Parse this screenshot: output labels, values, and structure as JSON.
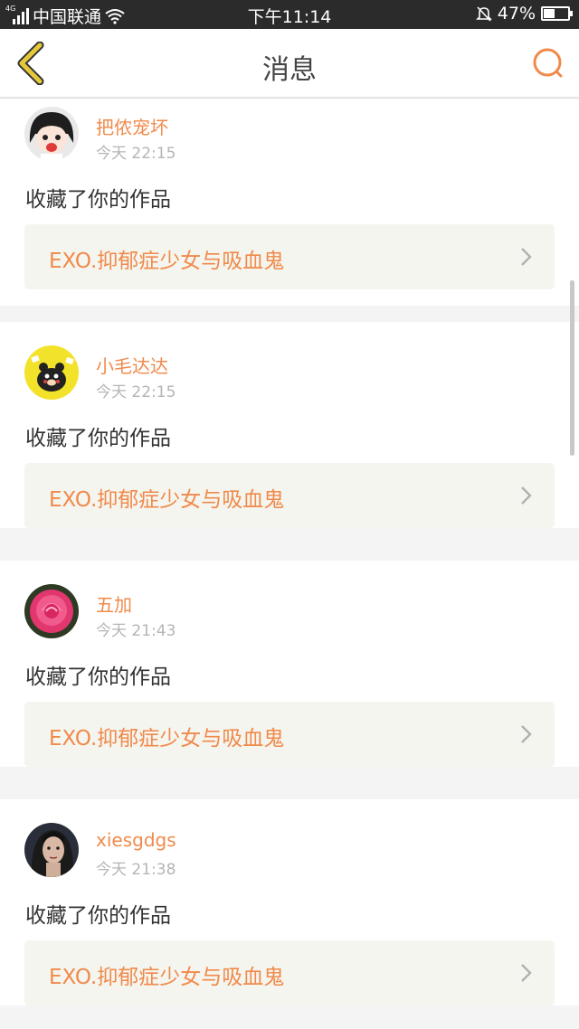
{
  "status_bar": {
    "network_label": "4G",
    "carrier": "中国联通",
    "time": "下午11:14",
    "battery_percent": "47%",
    "battery_level": 0.47,
    "icons": [
      "signal-icon",
      "wifi-icon",
      "mute-icon",
      "battery-icon"
    ]
  },
  "header": {
    "title": "消息",
    "back_icon": "chevron-left-icon",
    "search_icon": "search-icon"
  },
  "colors": {
    "accent": "#f08a4b",
    "back_icon": "#e6c93a",
    "link_bg": "#f5f5ef",
    "page_bg": "#f4f4f4",
    "status_bar_bg": "#2b2b2b"
  },
  "notifications": [
    {
      "username": "把侬宠坏",
      "time": "今天 22:15",
      "action": "收藏了你的作品",
      "work_title": "EXO.抑郁症少女与吸血鬼",
      "avatar": "anime-girl-avatar"
    },
    {
      "username": "小毛达达",
      "time": "今天 22:15",
      "action": "收藏了你的作品",
      "work_title": "EXO.抑郁症少女与吸血鬼",
      "avatar": "bear-on-yellow-avatar"
    },
    {
      "username": "五加",
      "time": "今天 21:43",
      "action": "收藏了你的作品",
      "work_title": "EXO.抑郁症少女与吸血鬼",
      "avatar": "pink-rose-avatar"
    },
    {
      "username": "xiesgdgs",
      "time": "今天 21:38",
      "action": "收藏了你的作品",
      "work_title": "EXO.抑郁症少女与吸血鬼",
      "avatar": "portrait-avatar"
    }
  ]
}
